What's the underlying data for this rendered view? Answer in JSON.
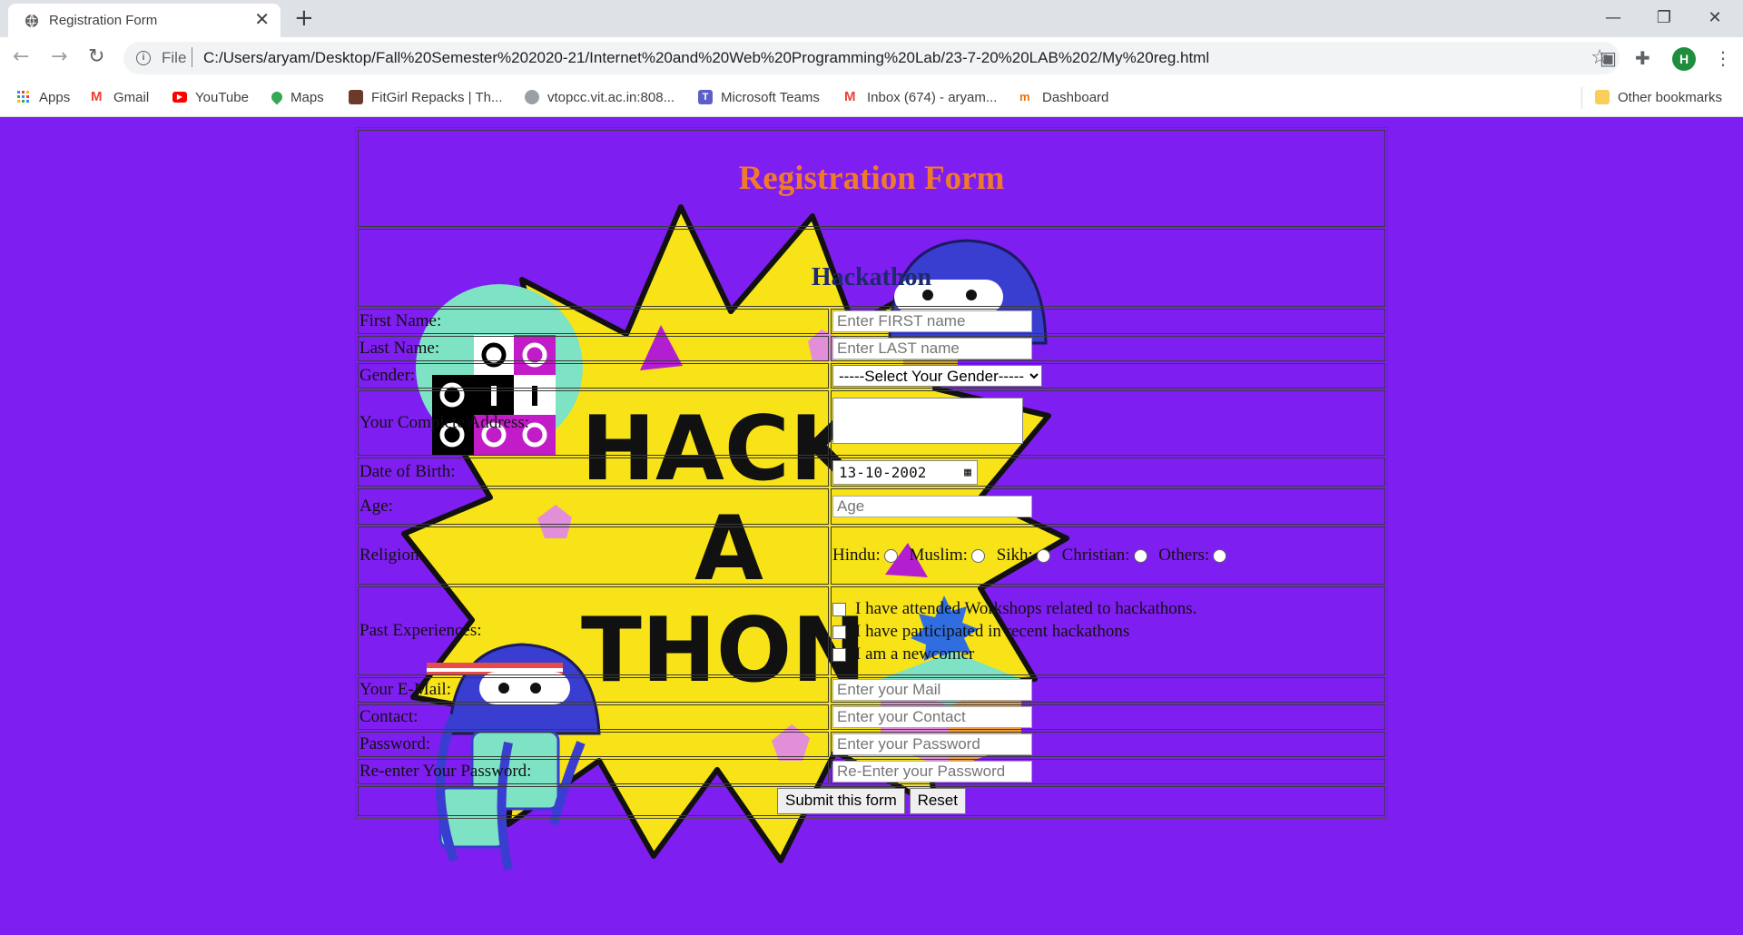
{
  "browser": {
    "tab_title": "Registration Form",
    "file_label": "File",
    "url": "C:/Users/aryam/Desktop/Fall%20Semester%202020-21/Internet%20and%20Web%20Programming%20Lab/23-7-20%20LAB%202/My%20reg.html",
    "avatar_letter": "H",
    "bookmarks": [
      {
        "label": "Apps",
        "icon": "apps-grid-icon"
      },
      {
        "label": "Gmail",
        "icon": "gmail-icon"
      },
      {
        "label": "YouTube",
        "icon": "youtube-icon"
      },
      {
        "label": "Maps",
        "icon": "maps-icon"
      },
      {
        "label": "FitGirl Repacks | Th...",
        "icon": "site-icon"
      },
      {
        "label": "vtopcc.vit.ac.in:808...",
        "icon": "site-icon"
      },
      {
        "label": "Microsoft Teams",
        "icon": "teams-icon"
      },
      {
        "label": "Inbox (674) - aryam...",
        "icon": "gmail-icon"
      },
      {
        "label": "Dashboard",
        "icon": "dashboard-icon"
      }
    ],
    "other_bookmarks": "Other bookmarks"
  },
  "form": {
    "title": "Registration Form",
    "subtitle": "Hackathon",
    "first_name": {
      "label": "First Name:",
      "placeholder": "Enter FIRST name"
    },
    "last_name": {
      "label": "Last Name:",
      "placeholder": "Enter LAST name"
    },
    "gender": {
      "label": "Gender:",
      "selected": "-----Select Your Gender-----"
    },
    "address": {
      "label": "Your Complete Address:"
    },
    "dob": {
      "label": "Date of Birth:",
      "value": "13-10-2002"
    },
    "age": {
      "label": "Age:",
      "placeholder": "Age"
    },
    "religion": {
      "label": "Religion:",
      "options": [
        "Hindu:",
        "Muslim:",
        "Sikh:",
        "Christian:",
        "Others:"
      ]
    },
    "experience": {
      "label": "Past Experiences:",
      "options": [
        "I have attended Workshops related to hackathons.",
        "I have participated in recent hackathons",
        "I am a newcomer"
      ]
    },
    "email": {
      "label": "Your E-Mail:",
      "placeholder": "Enter your Mail"
    },
    "contact": {
      "label": "Contact:",
      "placeholder": "Enter your Contact"
    },
    "password": {
      "label": "Password:",
      "placeholder": "Enter your Password"
    },
    "repassword": {
      "label": "Re-enter Your Password:",
      "placeholder": "Re-Enter your Password"
    },
    "submit_label": "Submit this form",
    "reset_label": "Reset"
  },
  "artwork": {
    "lines": [
      "HACK",
      "A",
      "THON"
    ]
  },
  "colors": {
    "page_bg": "#7f1ef0",
    "title": "#f07a2b",
    "subtitle": "#1d2a6b",
    "starburst": "#f7e318"
  }
}
